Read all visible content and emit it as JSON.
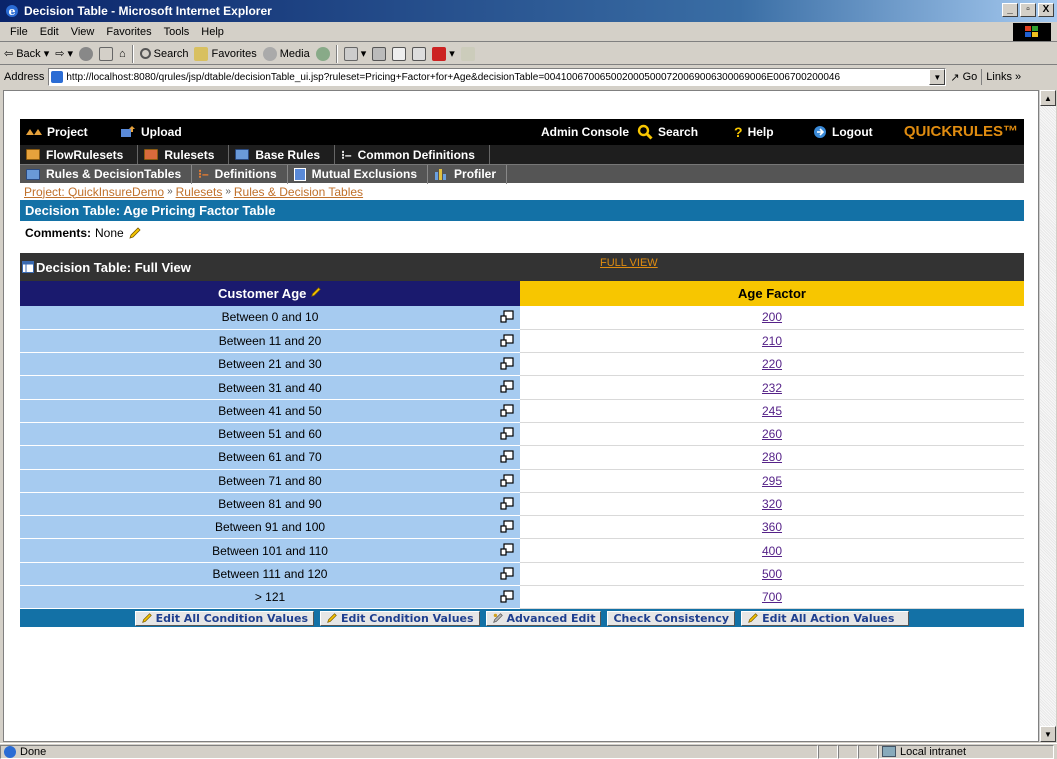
{
  "window": {
    "title": "Decision Table - Microsoft Internet Explorer",
    "min": "_",
    "max": "▫",
    "close": "X"
  },
  "menu": [
    "File",
    "Edit",
    "View",
    "Favorites",
    "Tools",
    "Help"
  ],
  "toolbar": {
    "back": "Back",
    "search": "Search",
    "favorites": "Favorites",
    "media": "Media"
  },
  "address": {
    "label": "Address",
    "url": "http://localhost:8080/qrules/jsp/dtable/decisionTable_ui.jsp?ruleset=Pricing+Factor+for+Age&decisionTable=0041006700650020005000720069006300069006E006700200046",
    "go": "Go",
    "links": "Links"
  },
  "app": {
    "brand": "QUICKRULES™",
    "top": {
      "project": "Project",
      "upload": "Upload",
      "admin": "Admin Console",
      "search": "Search",
      "help": "Help",
      "logout": "Logout"
    },
    "nav2": [
      "FlowRulesets",
      "Rulesets",
      "Base Rules",
      "Common Definitions"
    ],
    "nav3": [
      "Rules & DecisionTables",
      "Definitions",
      "Mutual Exclusions",
      "Profiler"
    ],
    "breadcrumb": {
      "project": "Project: QuickInsureDemo",
      "rulesets": "Rulesets",
      "rules": "Rules & Decision Tables",
      "sep": "»"
    },
    "dt_title": "Decision Table: Age Pricing Factor Table",
    "comments_label": "Comments:",
    "comments_value": "None",
    "fullview_title": "Decision Table: Full View",
    "fullview_link": "FULL VIEW",
    "table": {
      "cond_header": "Customer Age",
      "action_header": "Age Factor",
      "rows": [
        {
          "cond": "Between 0 and 10",
          "value": "200"
        },
        {
          "cond": "Between 11 and 20",
          "value": "210"
        },
        {
          "cond": "Between 21 and 30",
          "value": "220"
        },
        {
          "cond": "Between 31 and 40",
          "value": "232"
        },
        {
          "cond": "Between 41 and 50",
          "value": "245"
        },
        {
          "cond": "Between 51 and 60",
          "value": "260"
        },
        {
          "cond": "Between 61 and 70",
          "value": "280"
        },
        {
          "cond": "Between 71 and 80",
          "value": "295"
        },
        {
          "cond": "Between 81 and 90",
          "value": "320"
        },
        {
          "cond": "Between 91 and 100",
          "value": "360"
        },
        {
          "cond": "Between 101 and 110",
          "value": "400"
        },
        {
          "cond": "Between 111 and 120",
          "value": "500"
        },
        {
          "cond": "> 121",
          "value": "700"
        }
      ]
    },
    "buttons": {
      "edit_all_cond": "Edit All Condition Values",
      "edit_cond": "Edit Condition Values",
      "advanced": "Advanced Edit",
      "check": "Check Consistency",
      "edit_all_action": "Edit All Action Values"
    }
  },
  "status": {
    "text": "Done",
    "zone": "Local intranet"
  }
}
